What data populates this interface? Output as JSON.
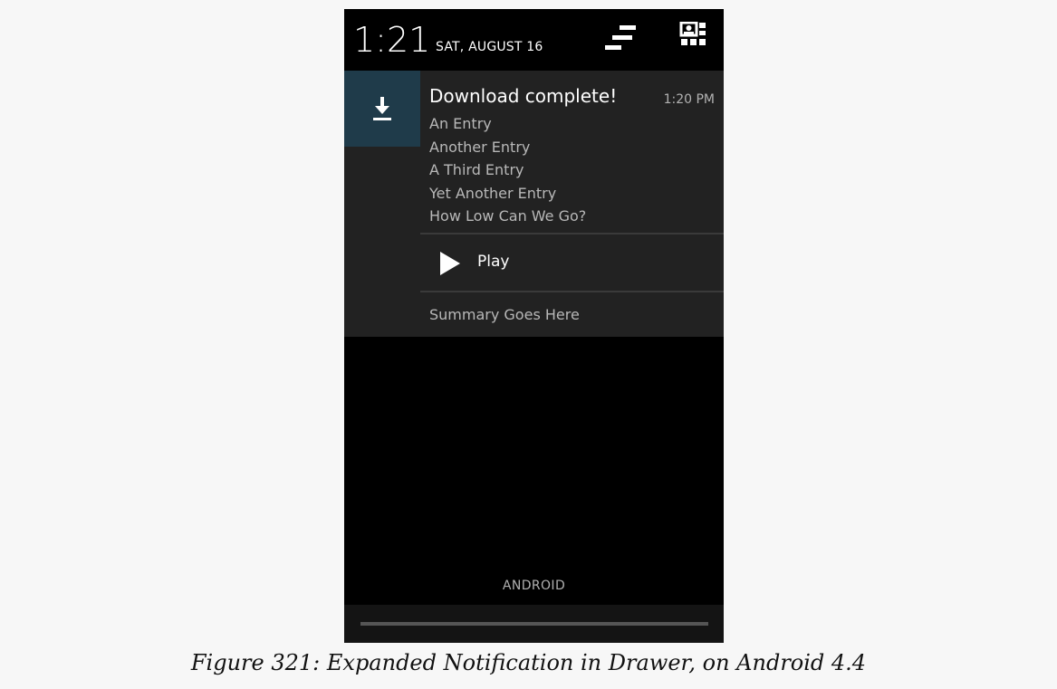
{
  "status": {
    "time": "1:21",
    "date": "SAT, AUGUST 16"
  },
  "header": {
    "settings_icon": "settings-bars-icon",
    "quick_settings_icon": "quick-settings-icon"
  },
  "notification": {
    "icon": "download-icon",
    "icon_bg_color": "#1f3b4a",
    "title": "Download complete!",
    "time": "1:20 PM",
    "lines": [
      "An Entry",
      "Another Entry",
      "A Third Entry",
      "Yet Another Entry",
      "How Low Can We Go?"
    ],
    "action": {
      "icon": "play-icon",
      "label": "Play"
    },
    "summary": "Summary Goes Here"
  },
  "carrier": "ANDROID",
  "caption": "Figure 321: Expanded Notification in Drawer, on Android 4.4"
}
